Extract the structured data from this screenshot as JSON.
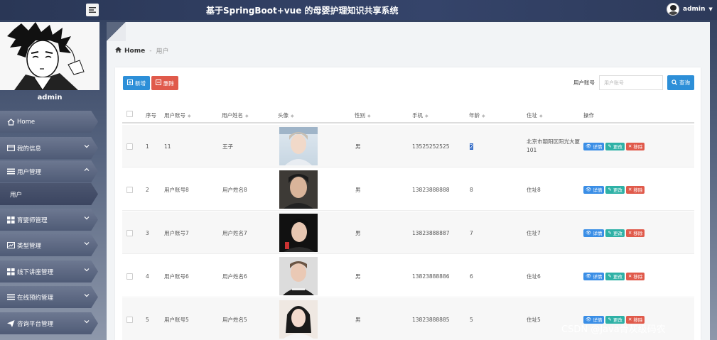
{
  "header": {
    "app_title": "基于SpringBoot+vue 的母婴护理知识共享系统",
    "username": "admin"
  },
  "sidebar": {
    "profile_name": "admin",
    "items": [
      {
        "label": "Home",
        "icon": "home-icon"
      },
      {
        "label": "我的信息",
        "icon": "id-card-icon"
      },
      {
        "label": "用户管理",
        "icon": "list-icon"
      },
      {
        "label": "用户",
        "icon": ""
      },
      {
        "label": "育婴师管理",
        "icon": "grid-icon"
      },
      {
        "label": "类型管理",
        "icon": "chart-icon"
      },
      {
        "label": "线下讲座管理",
        "icon": "grid-icon"
      },
      {
        "label": "在线预约管理",
        "icon": "list-icon"
      },
      {
        "label": "咨询平台管理",
        "icon": "send-icon"
      }
    ]
  },
  "breadcrumb": {
    "home": "Home",
    "current": "用户"
  },
  "toolbar": {
    "add_label": "新增",
    "delete_label": "删除"
  },
  "search": {
    "label": "用户账号",
    "placeholder": "用户账号",
    "button_label": "查询"
  },
  "table": {
    "columns": [
      "序号",
      "用户账号",
      "用户姓名",
      "头像",
      "性别",
      "手机",
      "年龄",
      "住址",
      "操作"
    ],
    "rows": [
      {
        "no": "1",
        "account": "11",
        "name": "王子",
        "gender": "男",
        "phone": "13525252525",
        "age": "2",
        "address": "北京市朝阳区阳光大厦101"
      },
      {
        "no": "2",
        "account": "用户账号8",
        "name": "用户姓名8",
        "gender": "男",
        "phone": "13823888888",
        "age": "8",
        "address": "住址8"
      },
      {
        "no": "3",
        "account": "用户账号7",
        "name": "用户姓名7",
        "gender": "男",
        "phone": "13823888887",
        "age": "7",
        "address": "住址7"
      },
      {
        "no": "4",
        "account": "用户账号6",
        "name": "用户姓名6",
        "gender": "男",
        "phone": "13823888886",
        "age": "6",
        "address": "住址6"
      },
      {
        "no": "5",
        "account": "用户账号5",
        "name": "用户姓名5",
        "gender": "男",
        "phone": "13823888885",
        "age": "5",
        "address": "住址5"
      }
    ],
    "actions": {
      "detail": "详情",
      "edit": "更改",
      "remove": "移除"
    }
  },
  "watermark": "CSDN @Java骨灰级码农",
  "colors": {
    "primary": "#2d8fd8",
    "danger": "#e05a4b",
    "success": "#2eb1a6",
    "topbar": "#2f3d5c"
  }
}
